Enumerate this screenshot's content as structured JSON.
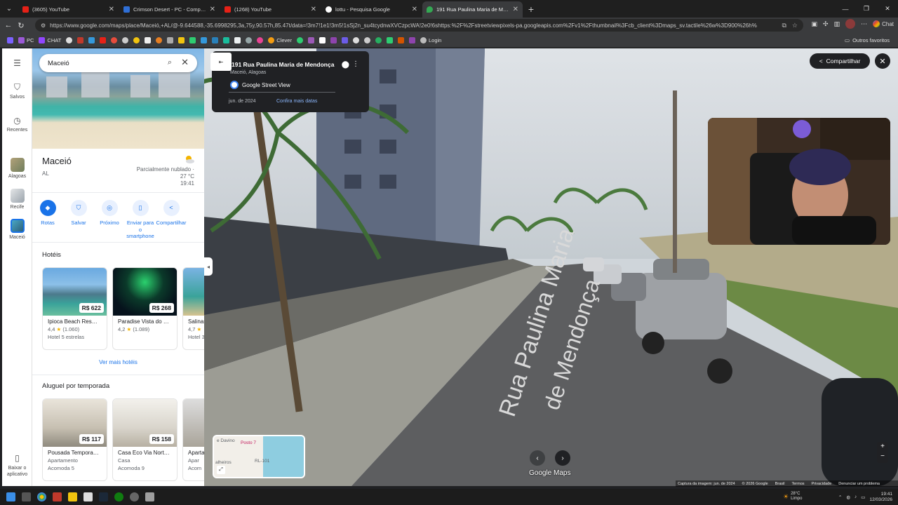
{
  "browser": {
    "tabs": [
      {
        "title": "(3605) YouTube",
        "color": "#e62117"
      },
      {
        "title": "Crimson Desert - PC - Compre na",
        "color": "#2f6fd6"
      },
      {
        "title": "(1268) YouTube",
        "color": "#e62117"
      },
      {
        "title": "lottu - Pesquisa Google",
        "color": "#4285f4"
      },
      {
        "title": "191 Rua Paulina Maria de Mendonç",
        "color": "#34a853"
      }
    ],
    "url": "https://www.google.com/maps/place/Maceió,+AL/@-9.644588,-35.6998295,3a,75y,90.57h,85.47t/data=!3m7!1e1!3m5!1sSj2n_su4tcydnwXVCzpcWA!2e0!6shttps:%2F%2Fstreetviewpixels-pa.googleapis.com%2Fv1%2Fthumbnail%3Fcb_client%3Dmaps_sv.tactile%26w%3D900%26h%",
    "chat_label": "Chat",
    "bookmarks": [
      "PC",
      "CHAT",
      "Clever",
      "Login"
    ],
    "bookmarks_right": "Outros favoritos"
  },
  "maps": {
    "rail": {
      "saved": "Salvos",
      "recent": "Recentes",
      "alagoas": "Alagoas",
      "recife": "Recife",
      "maceio": "Maceió",
      "download_app": "Baixar o aplicativo"
    },
    "search": {
      "value": "Maceió"
    },
    "place": {
      "name": "Maceió",
      "state": "AL",
      "weather": "Parcialmente nublado ·",
      "temp": "27 °C",
      "time": "19:41"
    },
    "actions": [
      {
        "label": "Rotas",
        "icon": "directions-icon"
      },
      {
        "label": "Salvar",
        "icon": "bookmark-icon"
      },
      {
        "label": "Próximo",
        "icon": "nearby-icon"
      },
      {
        "label": "Enviar para o smartphone",
        "icon": "phone-icon"
      },
      {
        "label": "Compartilhar",
        "icon": "share-icon"
      }
    ],
    "hotels": {
      "title": "Hotéis",
      "items": [
        {
          "name": "Ipioca Beach Res…",
          "price": "R$ 622",
          "rating": "4,4",
          "reviews": "(1.060)",
          "type": "Hotel 5 estrelas"
        },
        {
          "name": "Paradise Vista do …",
          "price": "R$ 268",
          "rating": "4,2",
          "reviews": "(1.089)",
          "type": ""
        },
        {
          "name": "Salinas",
          "price": "",
          "rating": "4,7",
          "reviews": "",
          "type": "Hotel 3"
        }
      ],
      "more": "Ver mais hotéis"
    },
    "rentals": {
      "title": "Aluguel por temporada",
      "items": [
        {
          "name": "Pousada Tempora…",
          "price": "R$ 117",
          "type": "Apartamento",
          "guests": "Acomoda 5"
        },
        {
          "name": "Casa Eco Via Nort…",
          "price": "R$ 158",
          "type": "Casa",
          "guests": "Acomoda 9"
        },
        {
          "name": "Aparta",
          "price": "",
          "type": "Apar",
          "guests": "Acom"
        }
      ]
    }
  },
  "streetview": {
    "address": "191 Rua Paulina Maria de Mendonça",
    "city": "Maceió, Alagoas",
    "provider": "Google Street View",
    "date": "jun. de 2024",
    "more_dates": "Confira mais datas",
    "share": "Compartilhar",
    "street_label_1": "Rua Paulina Maria",
    "street_label_2": "de Mendonça",
    "minimap_labels": [
      "e Davino",
      "Posto 7",
      "RL-101",
      "alheiros"
    ],
    "logo": "Google Maps",
    "attribution": [
      "Captura da imagem: jun. de 2024",
      "© 2026 Google",
      "Brasil",
      "Termos",
      "Privacidade",
      "Denunciar um problema"
    ]
  },
  "taskbar": {
    "temp": "28°C",
    "condition": "Limpo",
    "time": "19:41",
    "date": "12/03/2026"
  }
}
